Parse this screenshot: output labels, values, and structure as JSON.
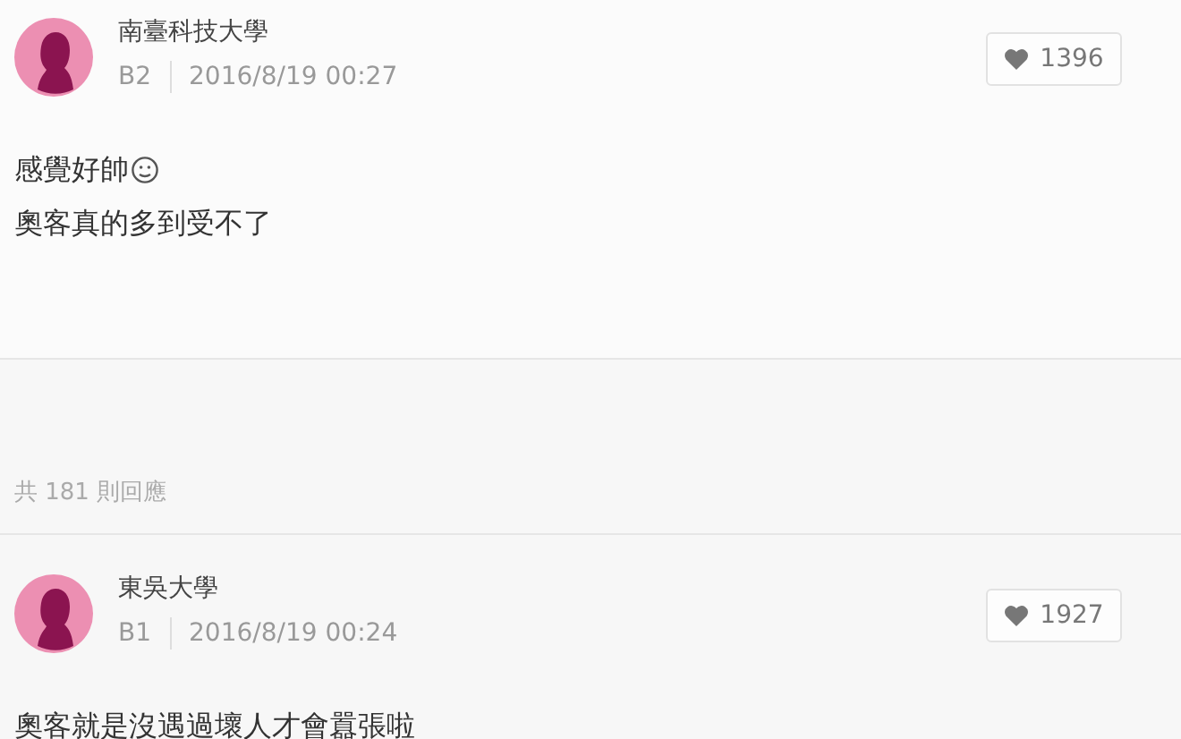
{
  "top_comment": {
    "school": "南臺科技大學",
    "floor": "B2",
    "time": "2016/8/19 00:27",
    "likes": "1396",
    "lines": [
      {
        "text": "感覺好帥",
        "emoji": true
      },
      {
        "text": "奧客真的多到受不了",
        "emoji": false
      }
    ]
  },
  "reply_count": "共 181 則回應",
  "comments": [
    {
      "school": "東吳大學",
      "floor": "B1",
      "time": "2016/8/19 00:24",
      "likes": "1927",
      "lines": [
        {
          "text": "奧客就是沒遇過壞人才會囂張啦",
          "emoji": false
        }
      ]
    }
  ]
}
